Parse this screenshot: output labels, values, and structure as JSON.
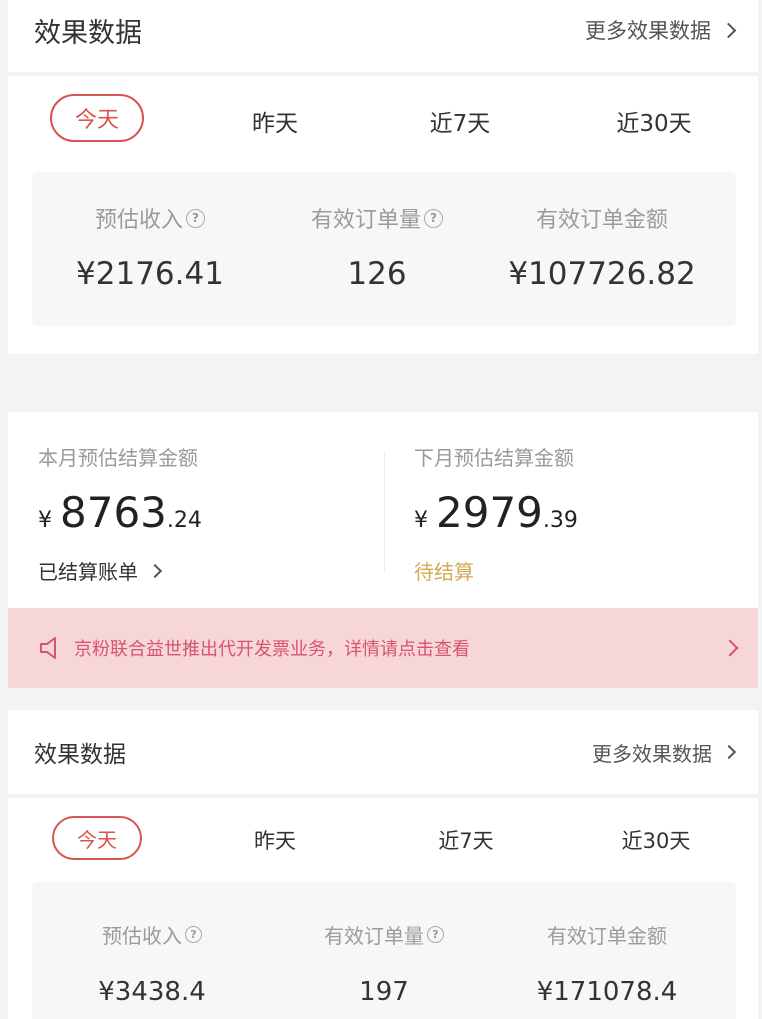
{
  "section1": {
    "title": "效果数据",
    "more": "更多效果数据",
    "tabs": [
      "今天",
      "昨天",
      "近7天",
      "近30天"
    ],
    "stats": [
      {
        "label": "预估收入",
        "value": "¥2176.41"
      },
      {
        "label": "有效订单量",
        "value": "126"
      },
      {
        "label": "有效订单金额",
        "value": "¥107726.82"
      }
    ]
  },
  "settlement": {
    "this_month_label": "本月预估结算金额",
    "this_month_currency": "¥",
    "this_month_int": "8763",
    "this_month_dec": ".24",
    "settled_bill": "已结算账单",
    "next_month_label": "下月预估结算金额",
    "next_month_currency": "¥",
    "next_month_int": "2979",
    "next_month_dec": ".39",
    "pending": "待结算"
  },
  "notice": {
    "text": "京粉联合益世推出代开发票业务，详情请点击查看"
  },
  "section2": {
    "title": "效果数据",
    "more": "更多效果数据",
    "tabs": [
      "今天",
      "昨天",
      "近7天",
      "近30天"
    ],
    "stats": [
      {
        "label": "预估收入",
        "value": "¥3438.4"
      },
      {
        "label": "有效订单量",
        "value": "197"
      },
      {
        "label": "有效订单金额",
        "value": "¥171078.4"
      }
    ]
  },
  "colors": {
    "accent": "#d9534f",
    "pending": "#d4aa52",
    "notice_bg": "#f7d6da",
    "notice_text": "#d7546a"
  }
}
